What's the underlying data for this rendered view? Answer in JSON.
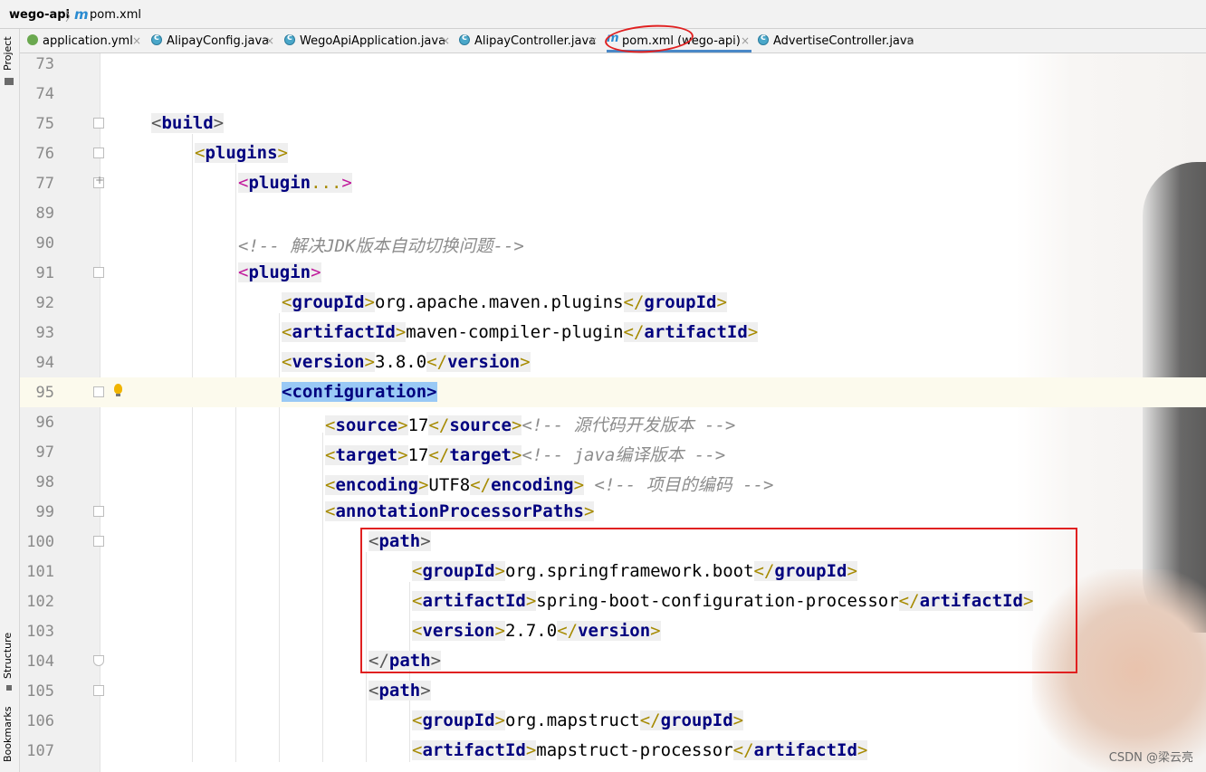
{
  "breadcrumb": {
    "project": "wego-api",
    "separator": "〉",
    "file_icon": "m",
    "file": "pom.xml"
  },
  "side_panels": {
    "project": "Project",
    "structure": "Structure",
    "bookmarks": "Bookmarks"
  },
  "tabs": [
    {
      "label": "application.yml",
      "icon": "spring-leaf-icon",
      "active": false
    },
    {
      "label": "AlipayConfig.java",
      "icon": "class-icon",
      "active": false
    },
    {
      "label": "WegoApiApplication.java",
      "icon": "class-icon",
      "active": false
    },
    {
      "label": "AlipayController.java",
      "icon": "class-icon",
      "active": false
    },
    {
      "label": "pom.xml (wego-api)",
      "icon": "maven-icon",
      "active": true
    },
    {
      "label": "AdvertiseController.java",
      "icon": "class-icon",
      "active": false
    }
  ],
  "tab_close": "×",
  "code_lines": [
    {
      "n": "73",
      "indent": 0,
      "tokens": []
    },
    {
      "n": "74",
      "indent": 0,
      "tokens": []
    },
    {
      "n": "75",
      "indent": 0,
      "fold": "start",
      "tokens": [
        [
          "br",
          "<"
        ],
        [
          "tn",
          "build"
        ],
        [
          "br",
          ">"
        ]
      ]
    },
    {
      "n": "76",
      "indent": 1,
      "fold": "start",
      "tokens": [
        [
          "bry",
          "<"
        ],
        [
          "tn",
          "plugins"
        ],
        [
          "bry",
          ">"
        ]
      ]
    },
    {
      "n": "77",
      "indent": 2,
      "fold": "plus",
      "tokens": [
        [
          "brp",
          "<"
        ],
        [
          "tn",
          "plugin"
        ],
        [
          "bry",
          "..."
        ],
        [
          "brp",
          ">"
        ]
      ]
    },
    {
      "n": "89",
      "indent": 0,
      "tokens": []
    },
    {
      "n": "90",
      "indent": 2,
      "tokens": [
        [
          "cm",
          "<!-- 解决JDK版本自动切换问题-->"
        ]
      ]
    },
    {
      "n": "91",
      "indent": 2,
      "fold": "start",
      "tokens": [
        [
          "brp",
          "<"
        ],
        [
          "tn",
          "plugin"
        ],
        [
          "brp",
          ">"
        ]
      ]
    },
    {
      "n": "92",
      "indent": 3,
      "tokens": [
        [
          "bry",
          "<"
        ],
        [
          "tn",
          "groupId"
        ],
        [
          "bry",
          ">"
        ],
        [
          "tx",
          "org.apache.maven.plugins"
        ],
        [
          "bry",
          "</"
        ],
        [
          "tn",
          "groupId"
        ],
        [
          "bry",
          ">"
        ]
      ]
    },
    {
      "n": "93",
      "indent": 3,
      "tokens": [
        [
          "bry",
          "<"
        ],
        [
          "tn",
          "artifactId"
        ],
        [
          "bry",
          ">"
        ],
        [
          "tx",
          "maven-compiler-plugin"
        ],
        [
          "bry",
          "</"
        ],
        [
          "tn",
          "artifactId"
        ],
        [
          "bry",
          ">"
        ]
      ]
    },
    {
      "n": "94",
      "indent": 3,
      "tokens": [
        [
          "bry",
          "<"
        ],
        [
          "tn",
          "version"
        ],
        [
          "bry",
          ">"
        ],
        [
          "tx",
          "3.8.0"
        ],
        [
          "bry",
          "</"
        ],
        [
          "tn",
          "version"
        ],
        [
          "bry",
          ">"
        ]
      ]
    },
    {
      "n": "95",
      "indent": 3,
      "fold": "start",
      "highlight": true,
      "bulb": true,
      "tokens": [
        [
          "sel",
          "<configuration>"
        ]
      ]
    },
    {
      "n": "96",
      "indent": 4,
      "tokens": [
        [
          "bry",
          "<"
        ],
        [
          "tn",
          "source"
        ],
        [
          "bry",
          ">"
        ],
        [
          "tx",
          "17"
        ],
        [
          "bry",
          "</"
        ],
        [
          "tn",
          "source"
        ],
        [
          "bry",
          ">"
        ],
        [
          "cm",
          "<!-- 源代码开发版本 -->"
        ]
      ]
    },
    {
      "n": "97",
      "indent": 4,
      "tokens": [
        [
          "bry",
          "<"
        ],
        [
          "tn",
          "target"
        ],
        [
          "bry",
          ">"
        ],
        [
          "tx",
          "17"
        ],
        [
          "bry",
          "</"
        ],
        [
          "tn",
          "target"
        ],
        [
          "bry",
          ">"
        ],
        [
          "cm",
          "<!-- java编译版本 -->"
        ]
      ]
    },
    {
      "n": "98",
      "indent": 4,
      "tokens": [
        [
          "bry",
          "<"
        ],
        [
          "tn",
          "encoding"
        ],
        [
          "bry",
          ">"
        ],
        [
          "tx",
          "UTF8"
        ],
        [
          "bry",
          "</"
        ],
        [
          "tn",
          "encoding"
        ],
        [
          "bry",
          ">"
        ],
        [
          "cm",
          " <!-- 项目的编码 -->"
        ]
      ]
    },
    {
      "n": "99",
      "indent": 4,
      "fold": "start",
      "tokens": [
        [
          "bry",
          "<"
        ],
        [
          "tn",
          "annotationProcessorPaths"
        ],
        [
          "bry",
          ">"
        ]
      ]
    },
    {
      "n": "100",
      "indent": 5,
      "fold": "start",
      "tokens": [
        [
          "br",
          "<"
        ],
        [
          "tn",
          "path"
        ],
        [
          "br",
          ">"
        ]
      ]
    },
    {
      "n": "101",
      "indent": 6,
      "tokens": [
        [
          "bry",
          "<"
        ],
        [
          "tn",
          "groupId"
        ],
        [
          "bry",
          ">"
        ],
        [
          "tx",
          "org.springframework.boot"
        ],
        [
          "bry",
          "</"
        ],
        [
          "tn",
          "groupId"
        ],
        [
          "bry",
          ">"
        ]
      ]
    },
    {
      "n": "102",
      "indent": 6,
      "tokens": [
        [
          "bry",
          "<"
        ],
        [
          "tn",
          "artifactId"
        ],
        [
          "bry",
          ">"
        ],
        [
          "tx",
          "spring-boot-configuration-processor"
        ],
        [
          "bry",
          "</"
        ],
        [
          "tn",
          "artifactId"
        ],
        [
          "bry",
          ">"
        ]
      ]
    },
    {
      "n": "103",
      "indent": 6,
      "tokens": [
        [
          "bry",
          "<"
        ],
        [
          "tn",
          "version"
        ],
        [
          "bry",
          ">"
        ],
        [
          "tx",
          "2.7.0"
        ],
        [
          "bry",
          "</"
        ],
        [
          "tn",
          "version"
        ],
        [
          "bry",
          ">"
        ]
      ]
    },
    {
      "n": "104",
      "indent": 5,
      "fold": "end",
      "tokens": [
        [
          "br",
          "</"
        ],
        [
          "tn",
          "path"
        ],
        [
          "br",
          ">"
        ]
      ]
    },
    {
      "n": "105",
      "indent": 5,
      "fold": "start",
      "tokens": [
        [
          "br",
          "<"
        ],
        [
          "tn",
          "path"
        ],
        [
          "br",
          ">"
        ]
      ]
    },
    {
      "n": "106",
      "indent": 6,
      "tokens": [
        [
          "bry",
          "<"
        ],
        [
          "tn",
          "groupId"
        ],
        [
          "bry",
          ">"
        ],
        [
          "tx",
          "org.mapstruct"
        ],
        [
          "bry",
          "</"
        ],
        [
          "tn",
          "groupId"
        ],
        [
          "bry",
          ">"
        ]
      ]
    },
    {
      "n": "107",
      "indent": 6,
      "tokens": [
        [
          "bry",
          "<"
        ],
        [
          "tn",
          "artifactId"
        ],
        [
          "bry",
          ">"
        ],
        [
          "tx",
          "mapstruct-processor"
        ],
        [
          "bry",
          "</"
        ],
        [
          "tn",
          "artifactId"
        ],
        [
          "bry",
          ">"
        ]
      ]
    }
  ],
  "watermark": "CSDN @梁云亮",
  "colors": {
    "tag_name": "#00007f",
    "comment": "#8c8c8c",
    "selection": "#99c9f5",
    "annotation_red": "#e02020",
    "current_line": "#fcfaed"
  }
}
